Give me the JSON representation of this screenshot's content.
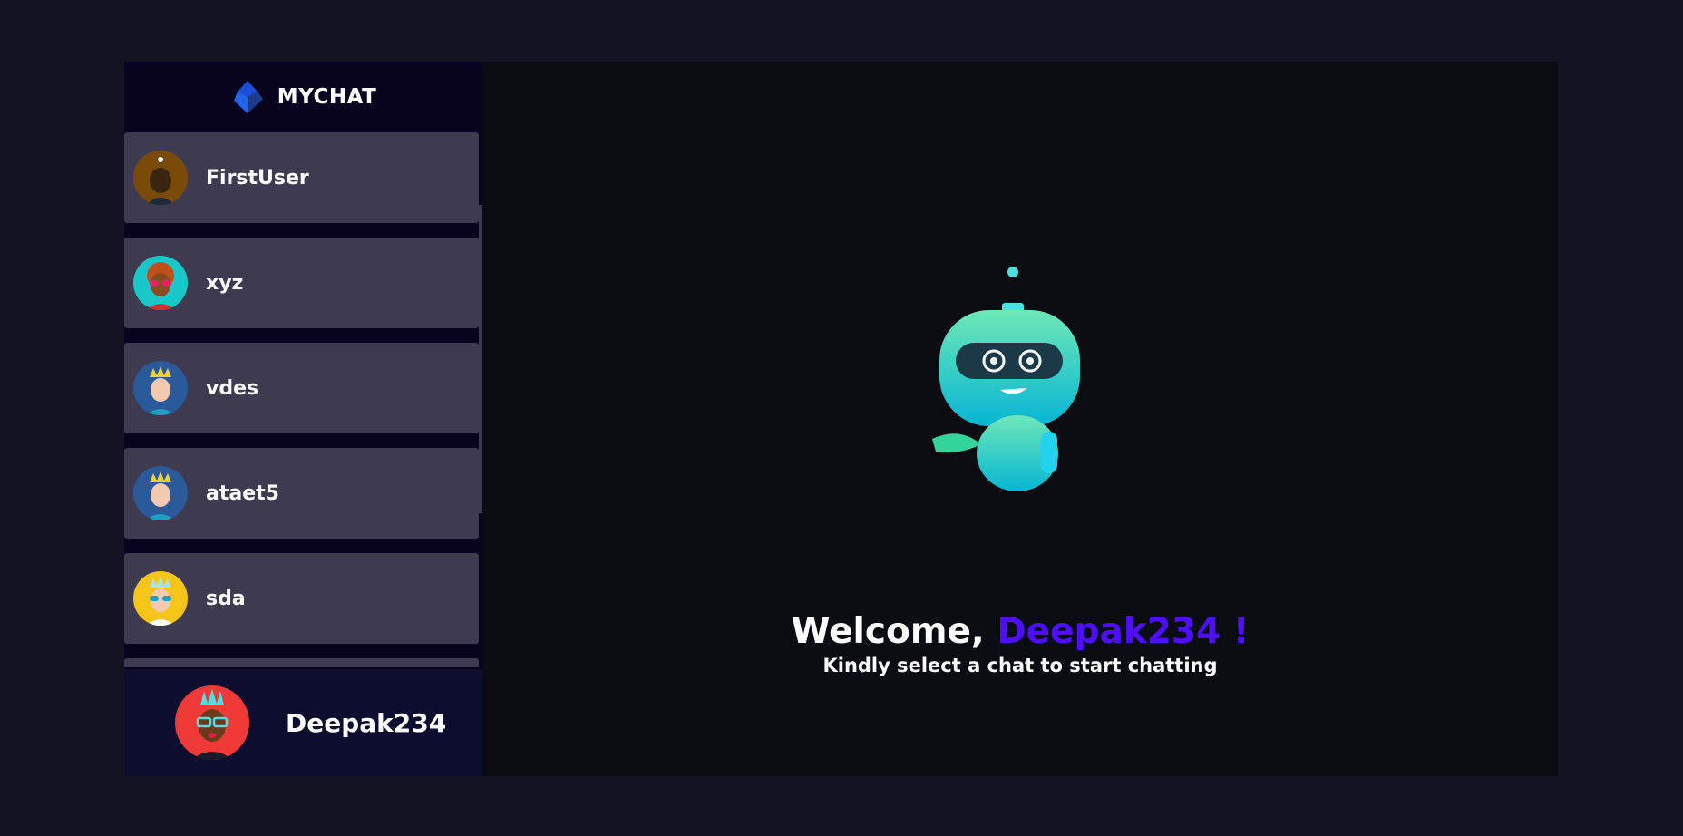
{
  "app": {
    "brand_name": "MYCHAT",
    "brand_icon": "diamond-logo-icon"
  },
  "contacts": [
    {
      "name": "FirstUser",
      "avatar_color": "#7a4a08",
      "avatar": "avatar-icon"
    },
    {
      "name": "xyz",
      "avatar_color": "#18c8c8",
      "avatar": "avatar-icon"
    },
    {
      "name": "vdes",
      "avatar_color": "#2a5a9a",
      "avatar": "avatar-icon"
    },
    {
      "name": "ataet5",
      "avatar_color": "#2a5a9a",
      "avatar": "avatar-icon"
    },
    {
      "name": "sda",
      "avatar_color": "#f5c518",
      "avatar": "avatar-icon"
    }
  ],
  "current_user": {
    "name": "Deepak234",
    "avatar_color": "#f03a3a"
  },
  "welcome": {
    "prefix": "Welcome, ",
    "username": "Deepak234 !",
    "subtitle": "Kindly select a chat to start chatting"
  },
  "colors": {
    "accent": "#4e0eff",
    "sidebar_bg": "#080420",
    "contact_bg": "#3e3a50",
    "page_bg": "#131324"
  }
}
